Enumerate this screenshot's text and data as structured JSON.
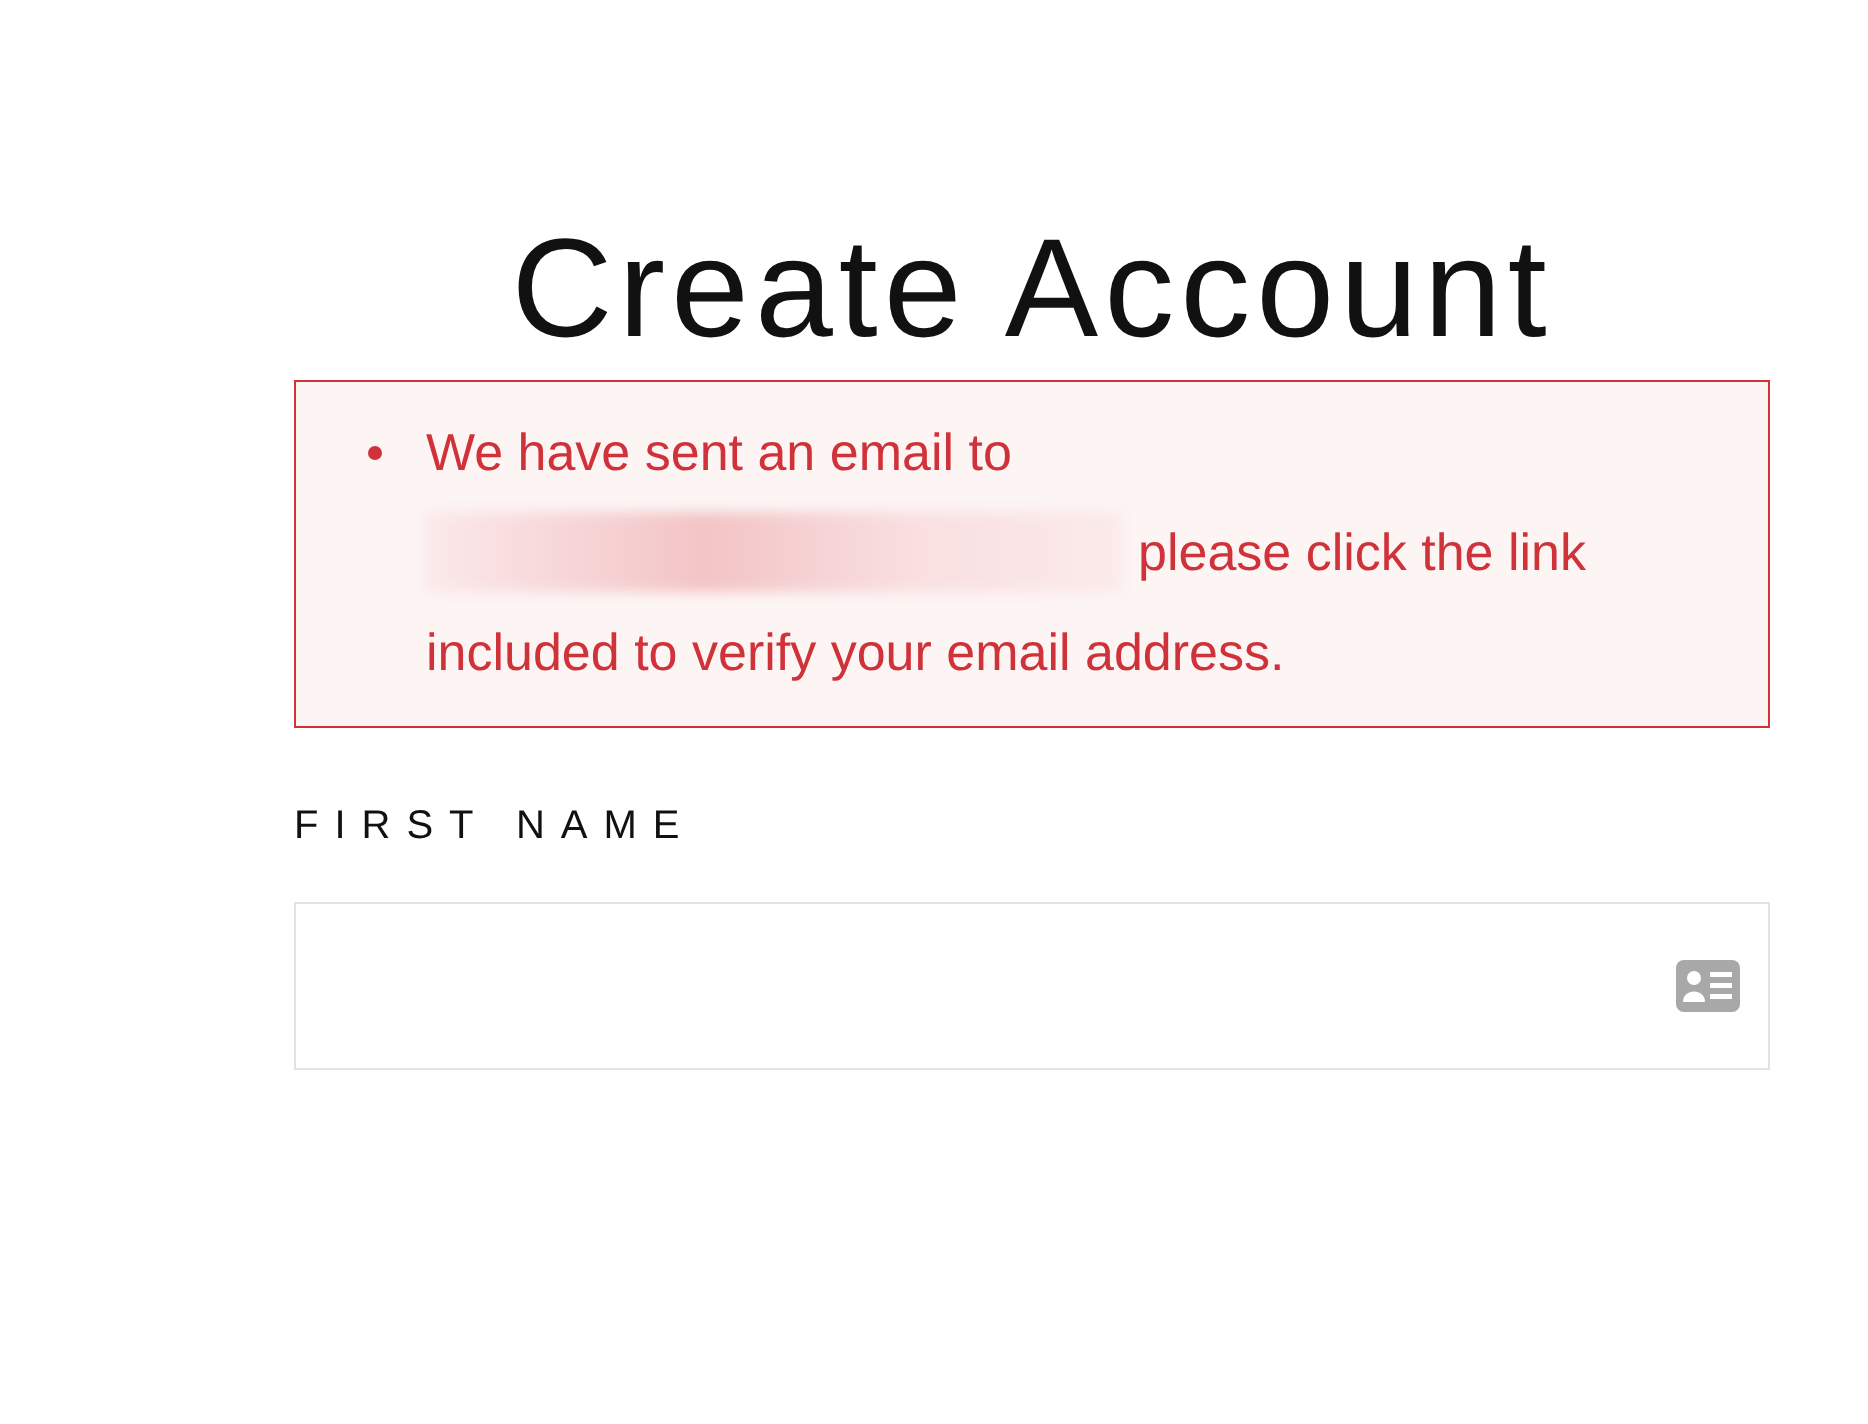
{
  "title": "Create Account",
  "alert": {
    "messages": [
      {
        "before": "We have sent an email to",
        "after": [
          "please click the link",
          "included to verify your email address."
        ]
      }
    ]
  },
  "fields": [
    {
      "label": "FIRST NAME"
    }
  ]
}
